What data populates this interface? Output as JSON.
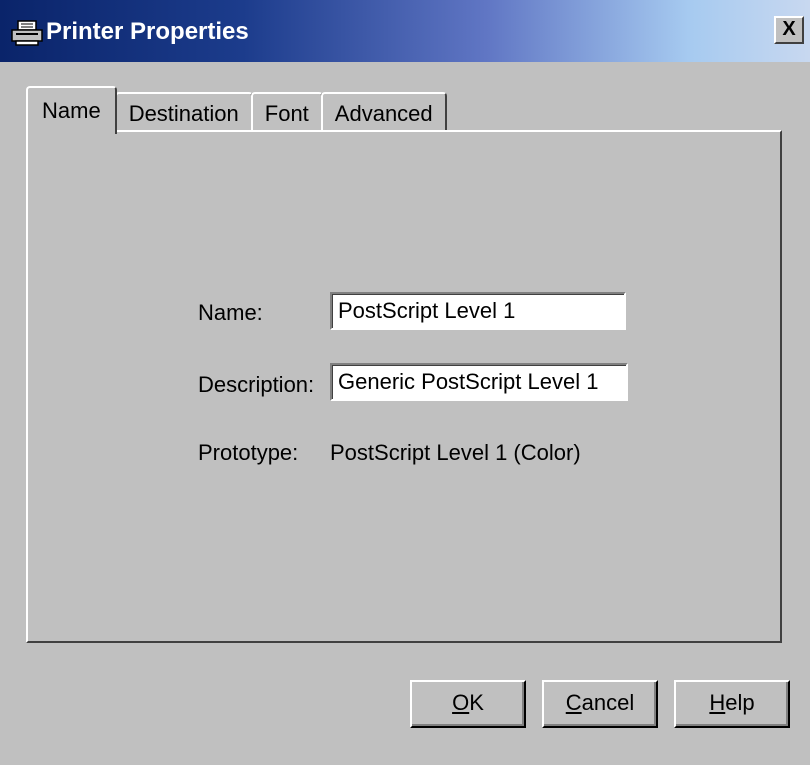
{
  "window": {
    "title": "Printer Properties",
    "title_icon": "printer-icon",
    "close_label": "X"
  },
  "tabs": [
    {
      "label": "Name",
      "active": true
    },
    {
      "label": "Destination",
      "active": false
    },
    {
      "label": "Font",
      "active": false
    },
    {
      "label": "Advanced",
      "active": false
    }
  ],
  "form": {
    "name_label": "Name:",
    "name_value": "PostScript Level 1",
    "description_label": "Description:",
    "description_value": "Generic PostScript Level 1",
    "prototype_label": "Prototype:",
    "prototype_value": "PostScript Level 1 (Color)"
  },
  "buttons": {
    "ok": {
      "mnemonic": "O",
      "rest": "K"
    },
    "cancel": {
      "mnemonic": "C",
      "rest": "ancel"
    },
    "help": {
      "mnemonic": "H",
      "rest": "elp"
    }
  },
  "colors": {
    "face": "#c0c0c0",
    "title_start": "#0a246a",
    "title_end": "#a6caf0"
  }
}
